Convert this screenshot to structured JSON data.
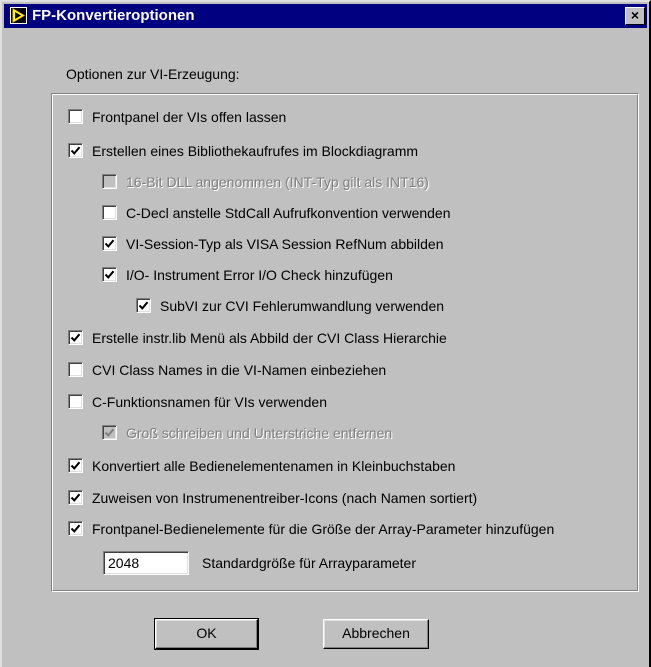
{
  "window": {
    "title": "FP-Konvertieroptionen",
    "close_label": "×"
  },
  "section_label": "Optionen zur VI-Erzeugung:",
  "options": [
    {
      "label": "Frontpanel der VIs offen lassen",
      "checked": false,
      "disabled": false
    },
    {
      "label": "Erstellen eines Bibliothekaufrufes im Blockdiagramm",
      "checked": true,
      "disabled": false
    },
    {
      "label": "16-Bit DLL angenommen (INT-Typ gilt als INT16)",
      "checked": false,
      "disabled": true
    },
    {
      "label": "C-Decl anstelle StdCall Aufrufkonvention verwenden",
      "checked": false,
      "disabled": false
    },
    {
      "label": "VI-Session-Typ als VISA Session RefNum abbilden",
      "checked": true,
      "disabled": false
    },
    {
      "label": "I/O- Instrument Error I/O Check hinzufügen",
      "checked": true,
      "disabled": false
    },
    {
      "label": "SubVI zur CVI Fehlerumwandlung verwenden",
      "checked": true,
      "disabled": false
    },
    {
      "label": "Erstelle instr.lib Menü als Abbild der CVI Class Hierarchie",
      "checked": true,
      "disabled": false
    },
    {
      "label": "CVI Class Names in die VI-Namen einbeziehen",
      "checked": false,
      "disabled": false
    },
    {
      "label": "C-Funktionsnamen für VIs verwenden",
      "checked": false,
      "disabled": false
    },
    {
      "label": "Groß schreiben und Unterstriche entfernen",
      "checked": true,
      "disabled": true
    },
    {
      "label": "Konvertiert alle Bedienelementenamen in Kleinbuchstaben",
      "checked": true,
      "disabled": false
    },
    {
      "label": "Zuweisen von Instrumenentreiber-Icons (nach Namen sortiert)",
      "checked": true,
      "disabled": false
    },
    {
      "label": "Frontpanel-Bedienelemente für die Größe der Array-Parameter hinzufügen",
      "checked": true,
      "disabled": false
    }
  ],
  "array_size": {
    "value": "2048",
    "label": "Standardgröße für Arrayparameter"
  },
  "buttons": {
    "ok": "OK",
    "cancel": "Abbrechen"
  }
}
